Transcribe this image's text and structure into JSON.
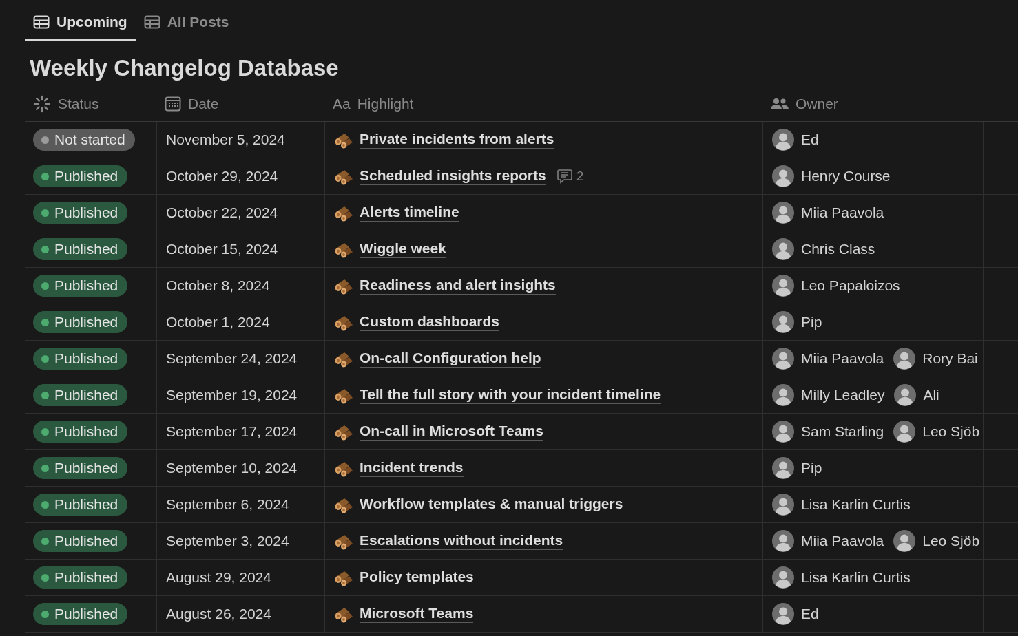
{
  "tabs": [
    {
      "label": "Upcoming",
      "selected": true
    },
    {
      "label": "All Posts",
      "selected": false
    }
  ],
  "title": "Weekly Changelog Database",
  "columns": [
    {
      "label": "Status",
      "kind": "status"
    },
    {
      "label": "Date",
      "kind": "date"
    },
    {
      "label": "Highlight",
      "kind": "title",
      "prefix": "Aa"
    },
    {
      "label": "Owner",
      "kind": "person"
    }
  ],
  "rows": [
    {
      "status": {
        "label": "Not started",
        "kind": "not_started"
      },
      "date": "November 5, 2024",
      "highlight": "Private incidents from alerts",
      "owners": [
        "Ed"
      ]
    },
    {
      "status": {
        "label": "Published",
        "kind": "published"
      },
      "date": "October 29, 2024",
      "highlight": "Scheduled insights reports",
      "comments": "2",
      "owners": [
        "Henry Course"
      ]
    },
    {
      "status": {
        "label": "Published",
        "kind": "published"
      },
      "date": "October 22, 2024",
      "highlight": "Alerts timeline",
      "owners": [
        "Miia Paavola"
      ]
    },
    {
      "status": {
        "label": "Published",
        "kind": "published"
      },
      "date": "October 15, 2024",
      "highlight": "Wiggle week",
      "owners": [
        "Chris Class"
      ]
    },
    {
      "status": {
        "label": "Published",
        "kind": "published"
      },
      "date": "October 8, 2024",
      "highlight": "Readiness and alert insights",
      "owners": [
        "Leo Papaloizos"
      ]
    },
    {
      "status": {
        "label": "Published",
        "kind": "published"
      },
      "date": "October 1, 2024",
      "highlight": "Custom dashboards",
      "owners": [
        "Pip"
      ]
    },
    {
      "status": {
        "label": "Published",
        "kind": "published"
      },
      "date": "September 24, 2024",
      "highlight": "On-call Configuration help",
      "owners": [
        "Miia Paavola",
        "Rory Bai"
      ]
    },
    {
      "status": {
        "label": "Published",
        "kind": "published"
      },
      "date": "September 19, 2024",
      "highlight": "Tell the full story with your incident timeline",
      "owners": [
        "Milly Leadley",
        "Ali"
      ]
    },
    {
      "status": {
        "label": "Published",
        "kind": "published"
      },
      "date": "September 17, 2024",
      "highlight": "On-call in Microsoft Teams",
      "owners": [
        "Sam Starling",
        "Leo Sjöb"
      ]
    },
    {
      "status": {
        "label": "Published",
        "kind": "published"
      },
      "date": "September 10, 2024",
      "highlight": "Incident trends",
      "owners": [
        "Pip"
      ]
    },
    {
      "status": {
        "label": "Published",
        "kind": "published"
      },
      "date": "September 6, 2024",
      "highlight": "Workflow templates & manual triggers",
      "owners": [
        "Lisa Karlin Curtis"
      ]
    },
    {
      "status": {
        "label": "Published",
        "kind": "published"
      },
      "date": "September 3, 2024",
      "highlight": "Escalations without incidents",
      "owners": [
        "Miia Paavola",
        "Leo Sjöb"
      ]
    },
    {
      "status": {
        "label": "Published",
        "kind": "published"
      },
      "date": "August 29, 2024",
      "highlight": "Policy templates",
      "owners": [
        "Lisa Karlin Curtis"
      ]
    },
    {
      "status": {
        "label": "Published",
        "kind": "published"
      },
      "date": "August 26, 2024",
      "highlight": "Microsoft Teams",
      "owners": [
        "Ed"
      ]
    }
  ]
}
